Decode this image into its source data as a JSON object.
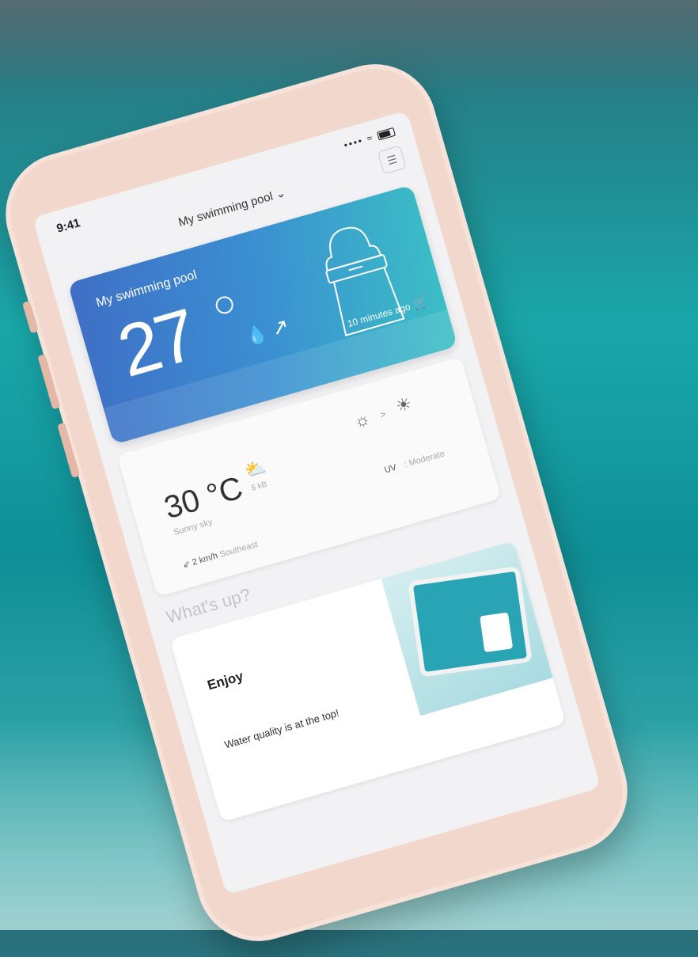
{
  "status_bar": {
    "time": "9:41",
    "signal": "•••• ≈"
  },
  "header": {
    "title": "My swimming pool ⌄",
    "menu_icon": "menu-icon"
  },
  "pool_card": {
    "title": "My swimming pool",
    "temperature": "27",
    "updated": "10 minutes ago"
  },
  "weather": {
    "temperature": "30 °C",
    "weather_sub": "6 kB",
    "air_sub": "Sunny sky",
    "uv_label": "UV",
    "uv_value": ": Moderate",
    "wind_speed": "2 km/h",
    "wind_dir": "Southeast"
  },
  "whats_up": {
    "title": "What's up?",
    "card_title": "Enjoy",
    "card_text": "Water quality is at the top!"
  },
  "colors": {
    "pool_gradient_start": "#3f6fc6",
    "pool_gradient_end": "#3bc0c5",
    "phone_case": "#f1d7cc"
  }
}
